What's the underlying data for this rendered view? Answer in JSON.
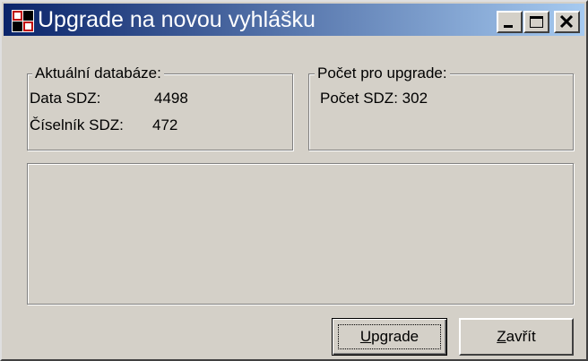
{
  "window": {
    "title": "Upgrade na novou vyhlášku",
    "icon": "app-table-icon",
    "controls": {
      "minimize": "minimize-icon",
      "maximize": "maximize-icon",
      "close": "close-icon"
    }
  },
  "current_db": {
    "legend": "Aktuální databáze:",
    "rows": [
      {
        "label": "Data SDZ:",
        "value": "4498"
      },
      {
        "label": "Číselník SDZ:",
        "value": "472"
      }
    ]
  },
  "upgrade_count": {
    "legend": "Počet pro upgrade:",
    "label": "Počet SDZ:",
    "value": "302"
  },
  "buttons": {
    "upgrade": {
      "mnemonic": "U",
      "rest": "pgrade"
    },
    "close": {
      "mnemonic": "Z",
      "rest": "avřít"
    }
  }
}
